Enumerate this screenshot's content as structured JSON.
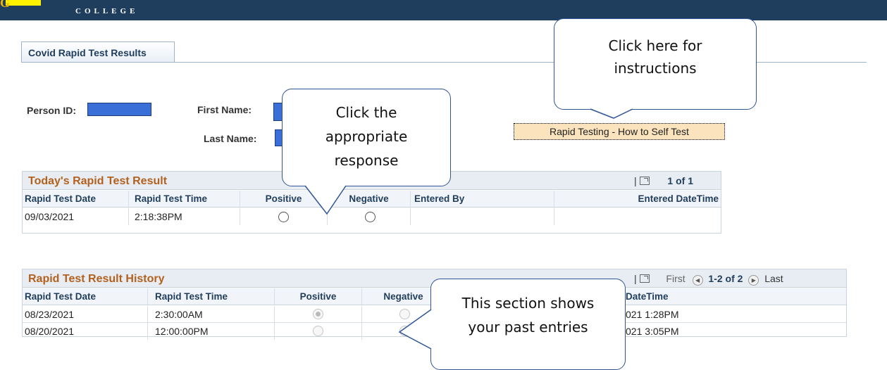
{
  "header": {
    "logo_letter": "G",
    "college_word": "COLLEGE"
  },
  "tab": {
    "label": "Covid Rapid Test Results"
  },
  "person": {
    "person_id_label": "Person ID:",
    "first_name_label": "First Name:",
    "last_name_label": "Last Name:"
  },
  "instructions_button": {
    "label": "Rapid Testing - How to Self Test"
  },
  "today": {
    "title": "Today's Rapid Test Result",
    "nav": {
      "separator": "|",
      "count": "1 of 1"
    },
    "columns": [
      "Rapid Test Date",
      "Rapid Test Time",
      "Positive",
      "Negative",
      "Entered By",
      "Entered DateTime"
    ],
    "rows": [
      {
        "date": "09/03/2021",
        "time": "2:18:38PM",
        "positive": false,
        "negative": false,
        "entered_by": "",
        "entered_datetime": ""
      }
    ]
  },
  "history": {
    "title": "Rapid Test Result History",
    "nav": {
      "separator": "|",
      "first": "First",
      "count": "1-2 of 2",
      "last": "Last"
    },
    "columns": [
      "Rapid Test Date",
      "Rapid Test Time",
      "Positive",
      "Negative",
      "DateTime"
    ],
    "rows": [
      {
        "date": "08/23/2021",
        "time": "2:30:00AM",
        "positive": true,
        "negative": false,
        "entered_datetime": "021 1:28PM"
      },
      {
        "date": "08/20/2021",
        "time": "12:00:00PM",
        "positive": false,
        "negative": true,
        "entered_datetime": "021 3:05PM"
      }
    ]
  },
  "callouts": {
    "instructions": [
      "Click here for",
      "instructions"
    ],
    "response": [
      "Click the",
      "appropriate",
      "response"
    ],
    "history": [
      "This section shows",
      "your past entries"
    ]
  },
  "colors": {
    "header_bg": "#1f3d5c",
    "logo_highlight": "#fff200",
    "grid_title_text": "#b3611e",
    "button_bg": "#fbe3bd",
    "redaction": "#3a6fd8",
    "callout_border": "#2f5597"
  }
}
